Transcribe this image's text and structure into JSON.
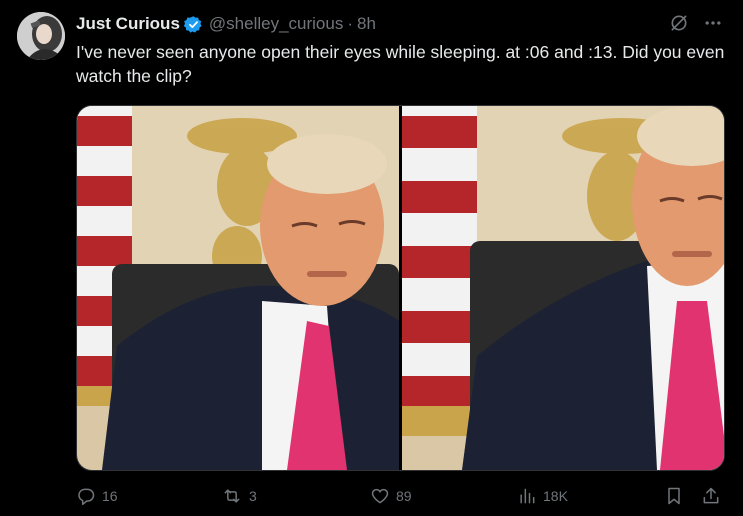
{
  "author": {
    "name": "Just Curious",
    "handle": "@shelley_curious",
    "time": "8h",
    "separator": "·"
  },
  "tweet": {
    "text": "I've never seen anyone open their eyes while sleeping. at :06 and :13. Did you even watch the clip?"
  },
  "stats": {
    "replies": "16",
    "reposts": "3",
    "likes": "89",
    "views": "18K"
  },
  "icons": {
    "verified": "verified-badge-icon",
    "grok": "grok-icon",
    "more": "more-icon",
    "reply": "reply-icon",
    "repost": "repost-icon",
    "like": "like-icon",
    "views": "views-icon",
    "bookmark": "bookmark-icon",
    "share": "share-icon"
  },
  "colors": {
    "background": "#000000",
    "text": "#e7e9ea",
    "muted": "#71767b",
    "verified": "#1d9bf0"
  }
}
